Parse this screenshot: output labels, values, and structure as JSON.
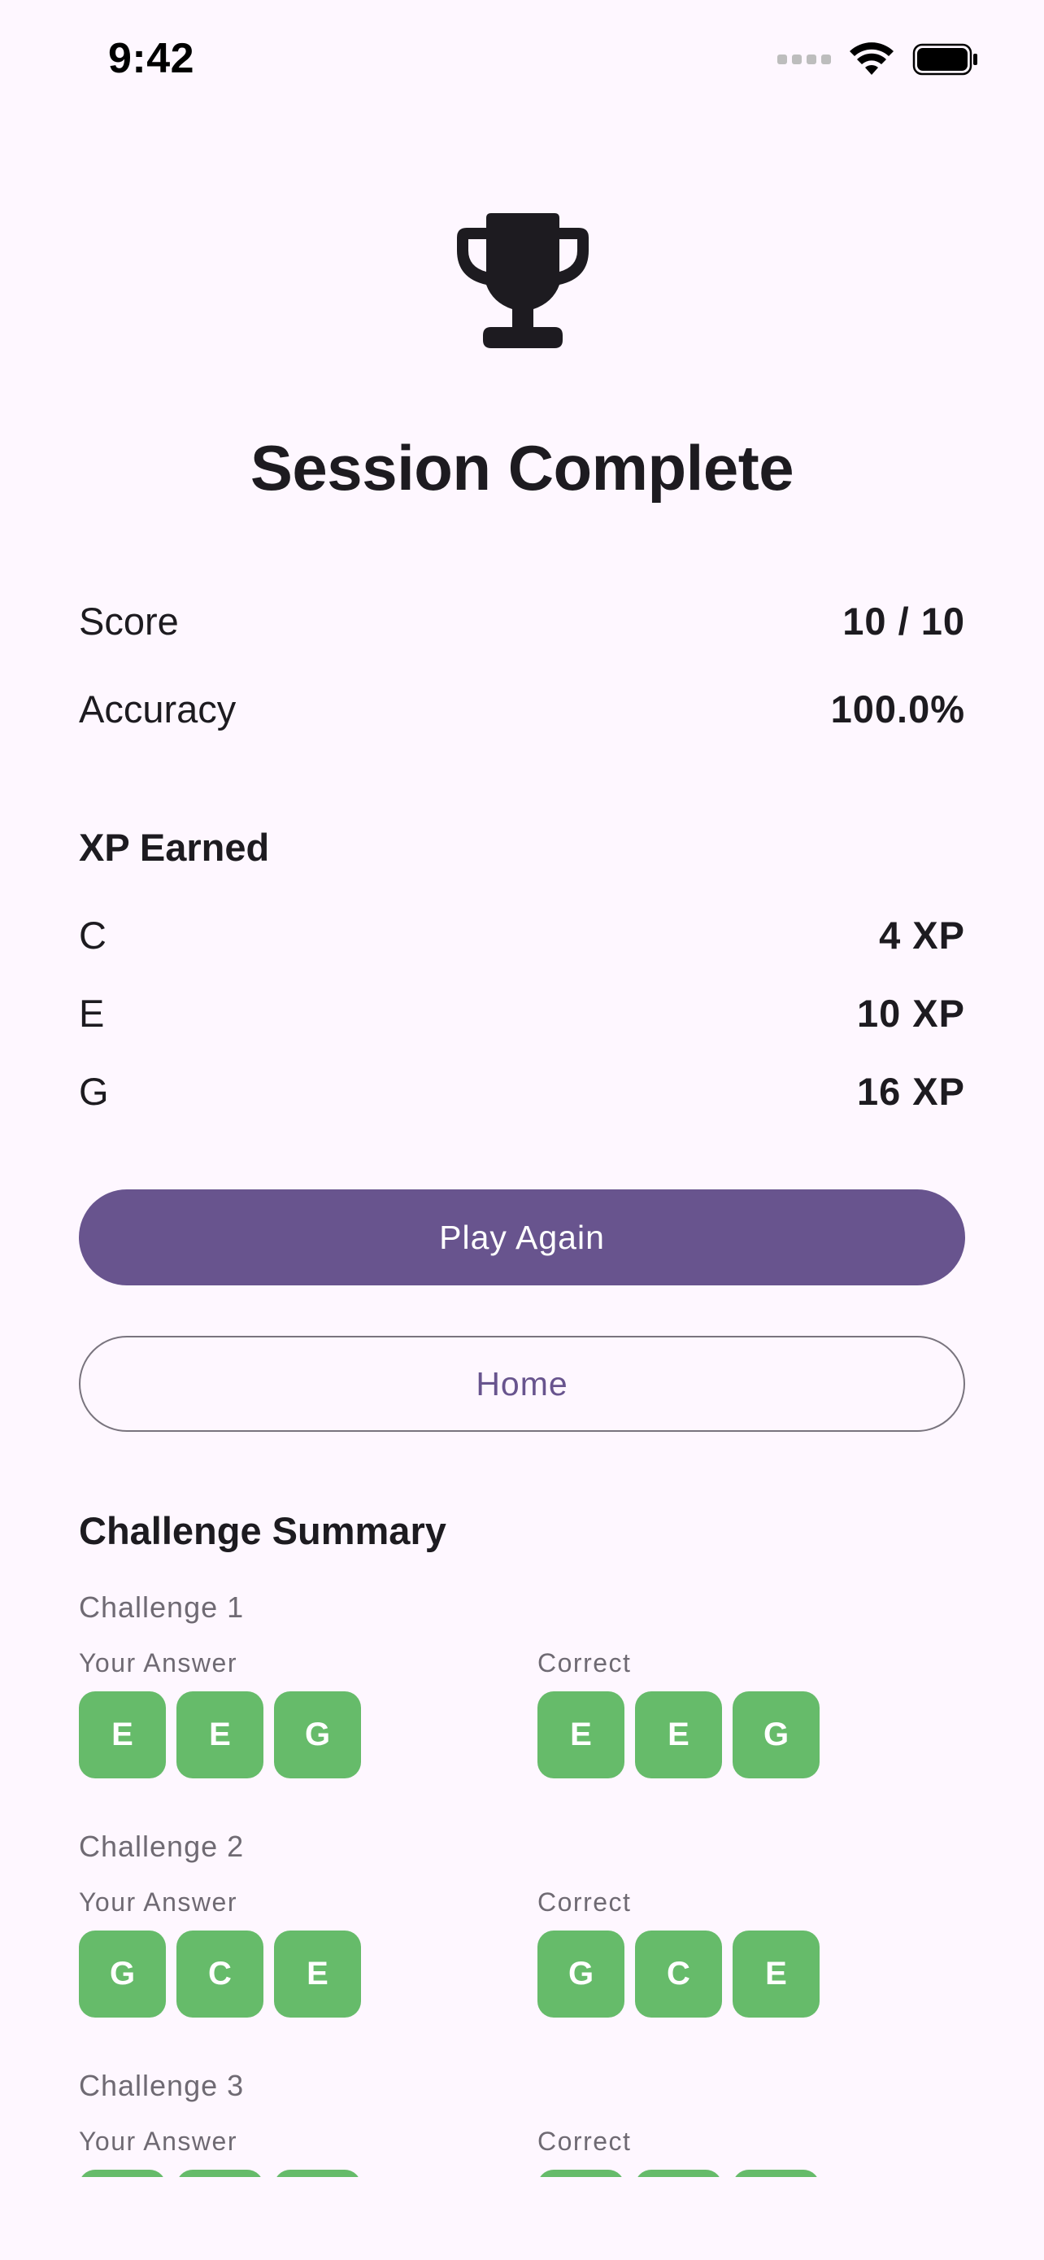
{
  "status_bar": {
    "time": "9:42"
  },
  "header": {
    "icon": "trophy-icon",
    "title": "Session Complete"
  },
  "stats": [
    {
      "label": "Score",
      "value": "10 / 10"
    },
    {
      "label": "Accuracy",
      "value": "100.0%"
    }
  ],
  "xp": {
    "heading": "XP Earned",
    "items": [
      {
        "label": "C",
        "value": "4 XP"
      },
      {
        "label": "E",
        "value": "10 XP"
      },
      {
        "label": "G",
        "value": "16 XP"
      }
    ]
  },
  "actions": {
    "play_again": "Play Again",
    "home": "Home"
  },
  "summary": {
    "heading": "Challenge Summary",
    "your_answer_label": "Your Answer",
    "correct_label": "Correct",
    "tile_color": "#66BB6A",
    "challenges": [
      {
        "label": "Challenge 1",
        "your_answer": [
          "E",
          "E",
          "G"
        ],
        "correct": [
          "E",
          "E",
          "G"
        ]
      },
      {
        "label": "Challenge 2",
        "your_answer": [
          "G",
          "C",
          "E"
        ],
        "correct": [
          "G",
          "C",
          "E"
        ]
      },
      {
        "label": "Challenge 3",
        "your_answer": [
          "",
          "",
          ""
        ],
        "correct": [
          "",
          "",
          ""
        ]
      }
    ]
  },
  "colors": {
    "background": "#FEF7FF",
    "primary": "#68548E",
    "success": "#66BB6A",
    "text": "#1D1B20",
    "muted": "#6F6A73"
  }
}
